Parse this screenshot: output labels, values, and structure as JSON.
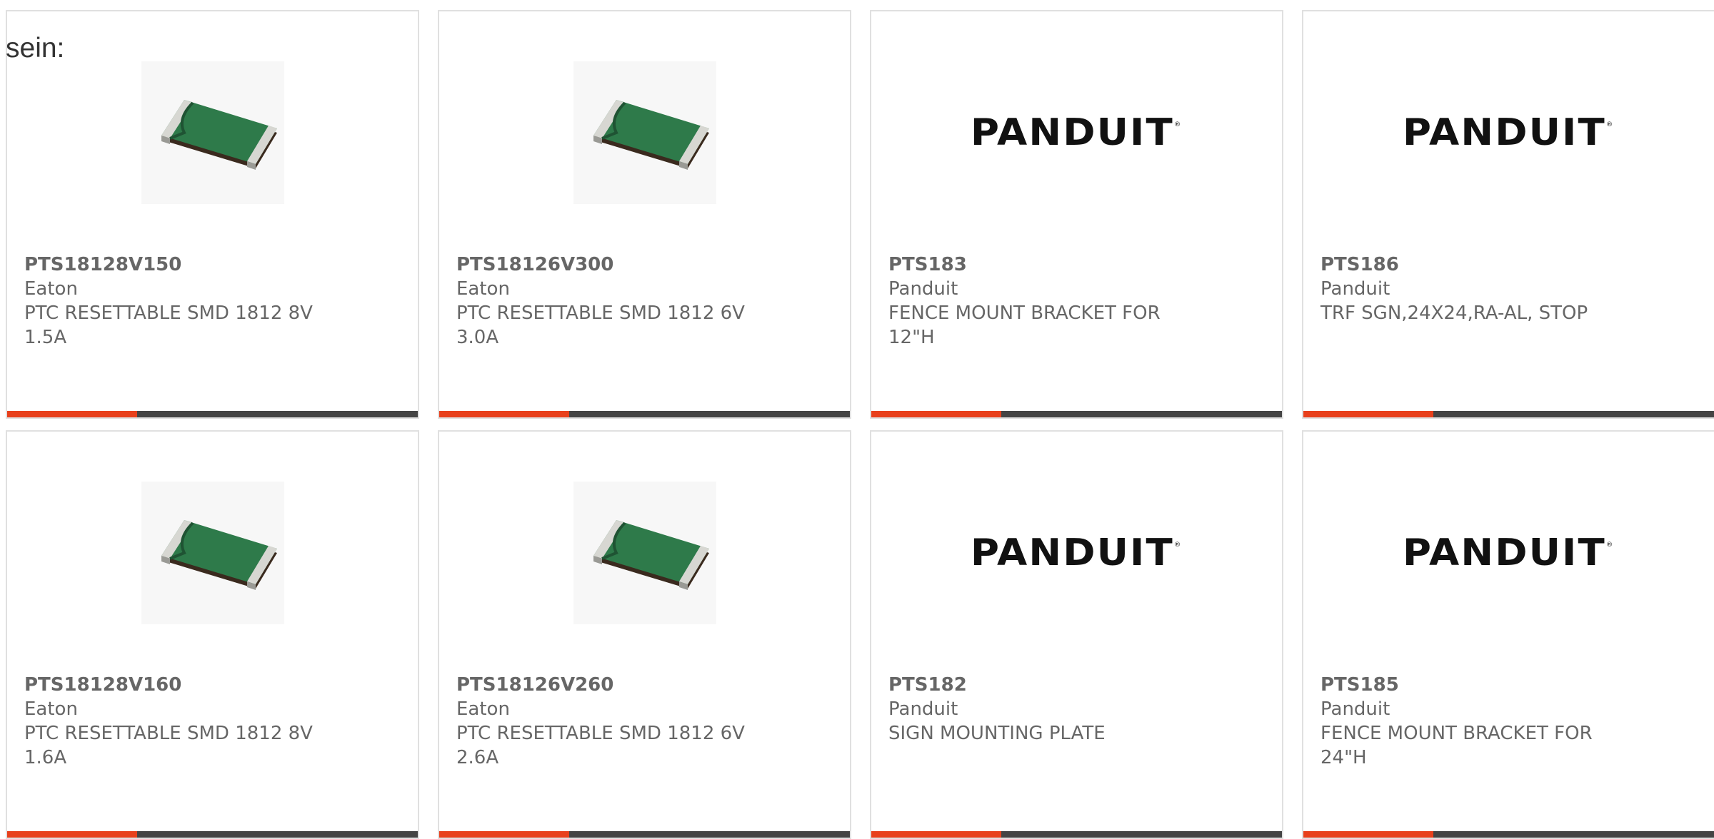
{
  "intro_text": "sein:",
  "colors": {
    "accent": "#e8401c",
    "bar": "#444444",
    "card_border": "#e0e0e0"
  },
  "products": [
    {
      "part": "PTS18128V150",
      "manufacturer": "Eaton",
      "description": "PTC RESETTABLE SMD 1812 8V 1.5A",
      "image": "ptc-fuse-image"
    },
    {
      "part": "PTS18126V300",
      "manufacturer": "Eaton",
      "description": "PTC RESETTABLE SMD 1812 6V 3.0A",
      "image": "ptc-fuse-image"
    },
    {
      "part": "PTS183",
      "manufacturer": "Panduit",
      "description": "FENCE MOUNT BRACKET FOR 12\"H",
      "image": "panduit-logo",
      "logo_text": "PANDUIT"
    },
    {
      "part": "PTS186",
      "manufacturer": "Panduit",
      "description": "TRF SGN,24X24,RA-AL, STOP",
      "image": "panduit-logo",
      "logo_text": "PANDUIT"
    },
    {
      "part": "PTS18128V160",
      "manufacturer": "Eaton",
      "description": "PTC RESETTABLE SMD 1812 8V 1.6A",
      "image": "ptc-fuse-image"
    },
    {
      "part": "PTS18126V260",
      "manufacturer": "Eaton",
      "description": "PTC RESETTABLE SMD 1812 6V 2.6A",
      "image": "ptc-fuse-image"
    },
    {
      "part": "PTS182",
      "manufacturer": "Panduit",
      "description": "SIGN MOUNTING PLATE",
      "image": "panduit-logo",
      "logo_text": "PANDUIT"
    },
    {
      "part": "PTS185",
      "manufacturer": "Panduit",
      "description": "FENCE MOUNT BRACKET FOR 24\"H",
      "image": "panduit-logo",
      "logo_text": "PANDUIT"
    }
  ]
}
